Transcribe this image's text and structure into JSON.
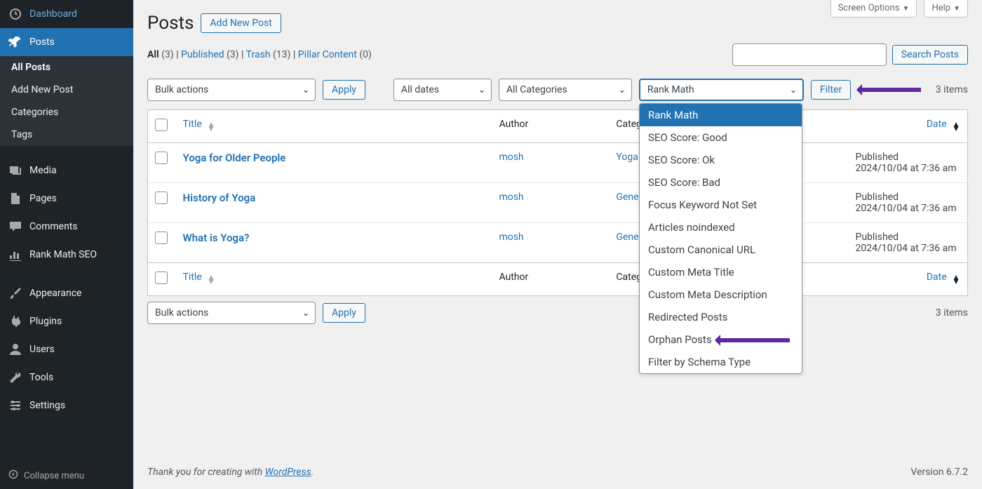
{
  "top": {
    "screen_options": "Screen Options",
    "help": "Help"
  },
  "sidebar": {
    "dashboard": "Dashboard",
    "posts": "Posts",
    "sub": {
      "all_posts": "All Posts",
      "add_new": "Add New Post",
      "categories": "Categories",
      "tags": "Tags"
    },
    "media": "Media",
    "pages": "Pages",
    "comments": "Comments",
    "rankmath": "Rank Math SEO",
    "appearance": "Appearance",
    "plugins": "Plugins",
    "users": "Users",
    "tools": "Tools",
    "settings": "Settings",
    "collapse": "Collapse menu"
  },
  "page": {
    "title": "Posts",
    "add_new_btn": "Add New Post"
  },
  "filters": {
    "all": {
      "label": "All",
      "count": "(3)"
    },
    "published": {
      "label": "Published",
      "count": "(3)"
    },
    "trash": {
      "label": "Trash",
      "count": "(13)"
    },
    "pillar": {
      "label": "Pillar Content",
      "count": "(0)"
    },
    "sep": " | "
  },
  "search": {
    "placeholder": "",
    "button": "Search Posts"
  },
  "bulk": {
    "bulk_actions": "Bulk actions",
    "apply": "Apply",
    "all_dates": "All dates",
    "all_categories": "All Categories",
    "rank_math": "Rank Math",
    "filter": "Filter",
    "items": "3 items"
  },
  "columns": {
    "title": "Title",
    "author": "Author",
    "categories": "Categories",
    "date": "Date"
  },
  "rows": [
    {
      "title": "Yoga for Older People",
      "author": "mosh",
      "cat": "Yoga for People",
      "date_state": "Published",
      "date_line": "2024/10/04 at 7:36 am"
    },
    {
      "title": "History of Yoga",
      "author": "mosh",
      "cat": "General Yoga",
      "date_state": "Published",
      "date_line": "2024/10/04 at 7:36 am"
    },
    {
      "title": "What is Yoga?",
      "author": "mosh",
      "cat": "General Yoga",
      "date_state": "Published",
      "date_line": "2024/10/04 at 7:36 am"
    }
  ],
  "dropdown": {
    "options": [
      "Rank Math",
      "SEO Score: Good",
      "SEO Score: Ok",
      "SEO Score: Bad",
      "Focus Keyword Not Set",
      "Articles noindexed",
      "Custom Canonical URL",
      "Custom Meta Title",
      "Custom Meta Description",
      "Redirected Posts",
      "Orphan Posts",
      "Filter by Schema Type"
    ],
    "selected": 0,
    "arrow_on": 10
  },
  "footer": {
    "thank_prefix": "Thank you for creating with ",
    "link": "WordPress",
    "suffix": ".",
    "version": "Version 6.7.2"
  }
}
